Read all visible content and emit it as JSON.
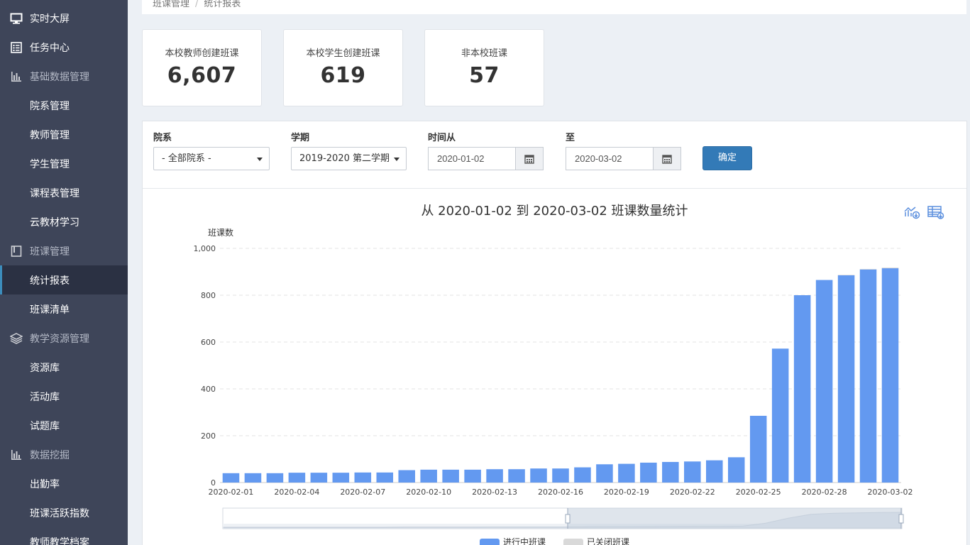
{
  "sidebar": {
    "items": [
      {
        "label": "实时大屏",
        "icon": "monitor-icon",
        "type": "top"
      },
      {
        "label": "任务中心",
        "icon": "task-list-icon",
        "type": "top"
      },
      {
        "label": "基础数据管理",
        "icon": "bar-chart-icon",
        "type": "group"
      },
      {
        "label": "院系管理",
        "type": "sub"
      },
      {
        "label": "教师管理",
        "type": "sub"
      },
      {
        "label": "学生管理",
        "type": "sub"
      },
      {
        "label": "课程表管理",
        "type": "sub"
      },
      {
        "label": "云教材学习",
        "type": "sub"
      },
      {
        "label": "班课管理",
        "icon": "book-icon",
        "type": "group"
      },
      {
        "label": "统计报表",
        "type": "sub",
        "active": true
      },
      {
        "label": "班课清单",
        "type": "sub"
      },
      {
        "label": "教学资源管理",
        "icon": "layers-icon",
        "type": "group"
      },
      {
        "label": "资源库",
        "type": "sub"
      },
      {
        "label": "活动库",
        "type": "sub"
      },
      {
        "label": "试题库",
        "type": "sub"
      },
      {
        "label": "数据挖掘",
        "icon": "bar-chart-icon",
        "type": "group"
      },
      {
        "label": "出勤率",
        "type": "sub"
      },
      {
        "label": "班课活跃指数",
        "type": "sub"
      },
      {
        "label": "教师教学档案",
        "type": "sub"
      }
    ]
  },
  "breadcrumb": {
    "parent": "班课管理",
    "sep": "/",
    "current": "统计报表"
  },
  "stats": [
    {
      "title": "本校教师创建班课",
      "value": "6,607"
    },
    {
      "title": "本校学生创建班课",
      "value": "619"
    },
    {
      "title": "非本校班课",
      "value": "57"
    }
  ],
  "filters": {
    "department_label": "院系",
    "department_value": "- 全部院系 -",
    "term_label": "学期",
    "term_value": "2019-2020 第二学期",
    "from_label": "时间从",
    "from_value": "2020-01-02",
    "to_label": "至",
    "to_value": "2020-03-02",
    "confirm_label": "确定"
  },
  "chart_title": "从 2020-01-02 到 2020-03-02 班课数量统计",
  "colors": {
    "bar": "#6399f0",
    "sidebar": "#3e4559",
    "primary": "#337ab7"
  },
  "chart_data": {
    "type": "bar",
    "title": "从 2020-01-02 到 2020-03-02 班课数量统计",
    "ylabel": "班课数",
    "xlabel": "",
    "ylim": [
      0,
      1000
    ],
    "yticks": [
      "0",
      "200",
      "400",
      "600",
      "800",
      "1,000"
    ],
    "grid": true,
    "legend_position": "bottom",
    "x_tick_labels": [
      "2020-02-01",
      "2020-02-04",
      "2020-02-07",
      "2020-02-10",
      "2020-02-13",
      "2020-02-16",
      "2020-02-19",
      "2020-02-22",
      "2020-02-25",
      "2020-02-28",
      "2020-03-02"
    ],
    "categories": [
      "2020-02-01",
      "2020-02-02",
      "2020-02-03",
      "2020-02-04",
      "2020-02-05",
      "2020-02-06",
      "2020-02-07",
      "2020-02-08",
      "2020-02-09",
      "2020-02-10",
      "2020-02-11",
      "2020-02-12",
      "2020-02-13",
      "2020-02-14",
      "2020-02-15",
      "2020-02-16",
      "2020-02-17",
      "2020-02-18",
      "2020-02-19",
      "2020-02-20",
      "2020-02-21",
      "2020-02-22",
      "2020-02-23",
      "2020-02-24",
      "2020-02-25",
      "2020-02-26",
      "2020-02-27",
      "2020-02-28",
      "2020-02-29",
      "2020-03-01",
      "2020-03-02"
    ],
    "series": [
      {
        "name": "进行中班课",
        "values": [
          40,
          40,
          40,
          42,
          42,
          42,
          43,
          43,
          53,
          55,
          55,
          55,
          57,
          57,
          60,
          60,
          65,
          78,
          80,
          85,
          88,
          90,
          95,
          108,
          285,
          572,
          800,
          865,
          885,
          910,
          915
        ]
      },
      {
        "name": "已关闭班课",
        "values": [
          0,
          0,
          0,
          0,
          0,
          0,
          0,
          0,
          0,
          0,
          0,
          0,
          0,
          0,
          0,
          0,
          0,
          0,
          0,
          0,
          0,
          0,
          0,
          0,
          0,
          0,
          0,
          0,
          2,
          2,
          3
        ]
      }
    ]
  }
}
